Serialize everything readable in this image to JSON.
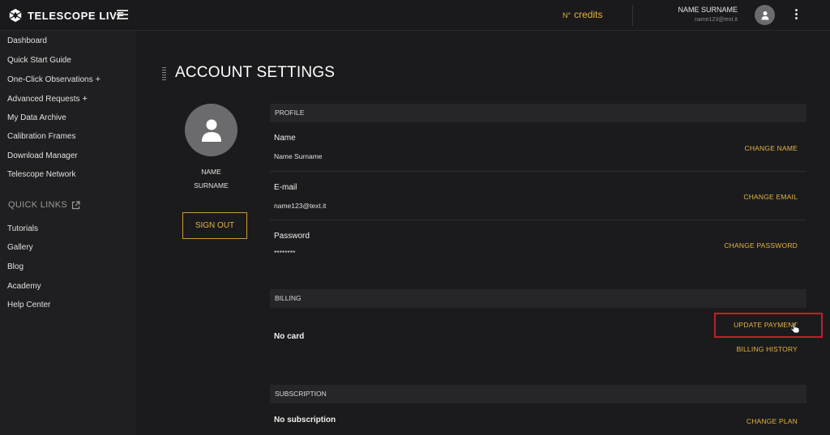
{
  "header": {
    "brand": "TELESCOPE LIVE",
    "credits_sup": "N°",
    "credits_label": "credits",
    "user_name": "NAME SURNAME",
    "user_email": "name123@text.it"
  },
  "sidebar": {
    "items": [
      {
        "label": "Dashboard"
      },
      {
        "label": "Quick Start Guide"
      },
      {
        "label": "One-Click Observations",
        "plus": "+"
      },
      {
        "label": "Advanced Requests",
        "plus": "+"
      },
      {
        "label": "My Data Archive"
      },
      {
        "label": "Calibration Frames"
      },
      {
        "label": "Download Manager"
      },
      {
        "label": "Telescope Network"
      }
    ],
    "quick_links_title": "QUICK LINKS",
    "quick_links": [
      {
        "label": "Tutorials"
      },
      {
        "label": "Gallery"
      },
      {
        "label": "Blog"
      },
      {
        "label": "Academy"
      },
      {
        "label": "Help Center"
      }
    ]
  },
  "main": {
    "title": "ACCOUNT SETTINGS",
    "profile_card": {
      "first_name": "NAME",
      "last_name": "SURNAME",
      "sign_out": "SIGN OUT"
    },
    "profile": {
      "header": "PROFILE",
      "name_label": "Name",
      "name_value": "Name Surname",
      "name_action": "CHANGE NAME",
      "email_label": "E-mail",
      "email_value": "name123@text.it",
      "email_action": "CHANGE EMAIL",
      "password_label": "Password",
      "password_value": "********",
      "password_action": "CHANGE PASSWORD"
    },
    "billing": {
      "header": "BILLING",
      "card_status": "No card",
      "update_action": "UPDATE PAYMENT",
      "history_action": "BILLING HISTORY"
    },
    "subscription": {
      "header": "SUBSCRIPTION",
      "status": "No subscription",
      "action": "CHANGE PLAN"
    }
  },
  "colors": {
    "accent": "#e5b43f",
    "highlight": "#c0202a",
    "background": "#1b1b1d"
  }
}
